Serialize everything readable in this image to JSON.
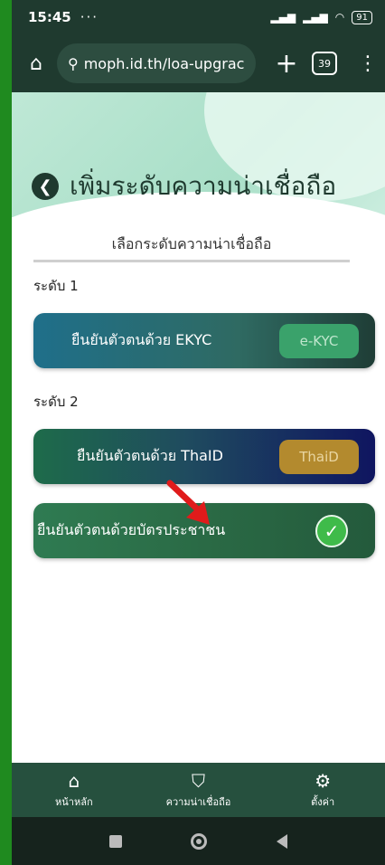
{
  "status": {
    "time": "15:45",
    "dots": "···",
    "battery": "91"
  },
  "browser": {
    "url": "moph.id.th/loa-upgrac",
    "tab_count": "39"
  },
  "page": {
    "title": "เพิ่มระดับความน่าเชื่อถือ",
    "subtitle": "เลือกระดับความน่าเชื่อถือ",
    "level1_label": "ระดับ 1",
    "level2_label": "ระดับ 2",
    "options": [
      {
        "label": "ยืนยันตัวตนด้วย EKYC",
        "badge": "e-KYC"
      },
      {
        "label": "ยืนยันตัวตนด้วย ThaID",
        "badge": "ThaiD"
      },
      {
        "label": "ยืนยันตัวตนด้วยบัตรประชาชน",
        "badge": ""
      }
    ]
  },
  "bottom_nav": {
    "home": "หน้าหลัก",
    "trust": "ความน่าเชื่อถือ",
    "settings": "ตั้งค่า"
  },
  "colors": {
    "accent": "#1f3a2f",
    "green": "#1f8a1f"
  }
}
